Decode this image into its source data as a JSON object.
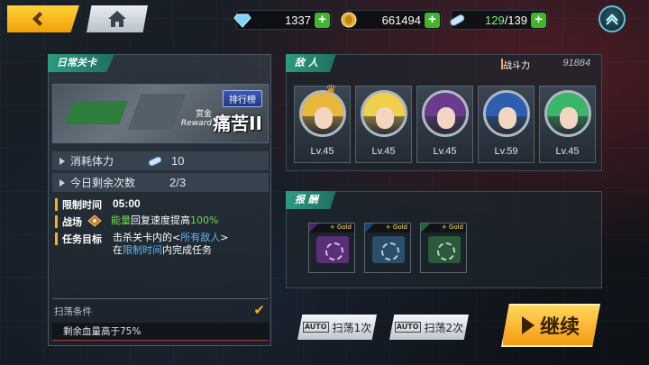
{
  "topbar": {
    "gems": "1337",
    "gold": "661494",
    "stamina_current": "129",
    "stamina_max": "/139"
  },
  "daily": {
    "tab_label": "日常关卡",
    "rank_label": "排行榜",
    "bounty_cn": "赏金",
    "bounty_en": "Reward",
    "stage_name": "痛苦II",
    "cost_label": "消耗体力",
    "cost_value": "10",
    "remaining_label": "今日剩余次数",
    "remaining_value": "2/3",
    "time_limit_key": "限制时间",
    "time_limit_value": "05:00",
    "battlefield_key": "战场",
    "battlefield_hl": "能量",
    "battlefield_text": "回复速度提高",
    "battlefield_pct": "100%",
    "mission_key": "任务目标",
    "mission_line1_a": "击杀关卡内的<",
    "mission_line1_hl": "所有敌人",
    "mission_line1_b": ">",
    "mission_line2_a": "在",
    "mission_line2_hl": "限制时间",
    "mission_line2_b": "内完成任务",
    "sweep_condition_label": "扫荡条件",
    "sweep_condition_value": "剩余血量高于75%"
  },
  "enemies": {
    "title": "敌 人",
    "power_label": "战斗力",
    "power_value": "91884",
    "list": [
      {
        "level": "Lv.45",
        "hair": "#e8b73c"
      },
      {
        "level": "Lv.45",
        "hair": "#f0d04a"
      },
      {
        "level": "Lv.45",
        "hair": "#6a3a8c"
      },
      {
        "level": "Lv.59",
        "hair": "#2d5fb0"
      },
      {
        "level": "Lv.45",
        "hair": "#3ab56a"
      }
    ]
  },
  "rewards": {
    "title": "报 酬",
    "items": [
      {
        "tag": "+ Gold",
        "color": "#7a3fb0",
        "chip": "#5a2f78"
      },
      {
        "tag": "+ Gold",
        "color": "#2d6fd0",
        "chip": "#2a4f6a"
      },
      {
        "tag": "+ Gold",
        "color": "#3fa55a",
        "chip": "#2a5a3a"
      }
    ]
  },
  "actions": {
    "auto_text": "AUTO",
    "sweep1": "扫荡1次",
    "sweep2": "扫荡2次",
    "continue": "继续"
  }
}
